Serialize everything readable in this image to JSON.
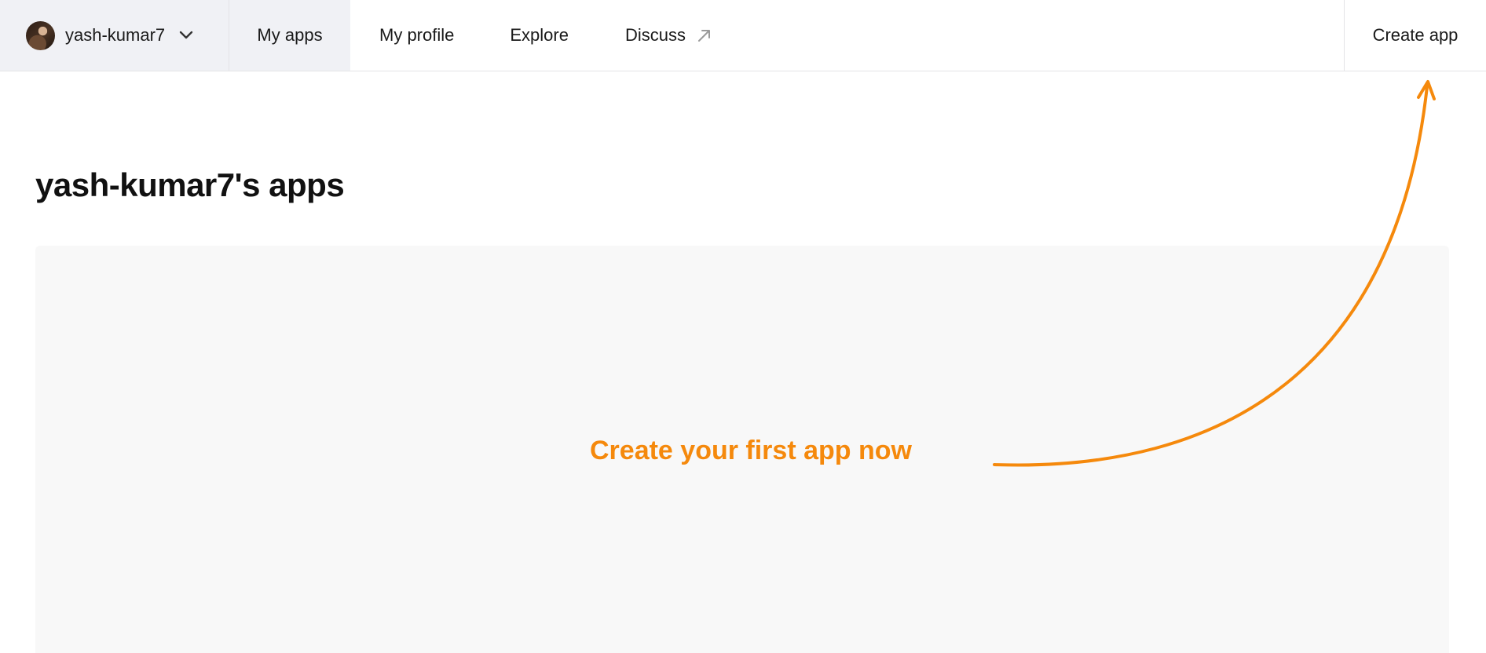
{
  "header": {
    "user": {
      "name": "yash-kumar7",
      "avatar_icon": "user-avatar"
    },
    "nav": [
      {
        "label": "My apps",
        "active": true
      },
      {
        "label": "My profile",
        "active": false
      },
      {
        "label": "Explore",
        "active": false
      },
      {
        "label": "Discuss",
        "active": false,
        "external": true
      }
    ],
    "create_app_label": "Create app"
  },
  "main": {
    "title": "yash-kumar7's apps",
    "empty_state": {
      "cta": "Create your first app now"
    }
  },
  "colors": {
    "accent": "#f5890c",
    "nav_active_bg": "#f0f1f5",
    "panel_bg": "#f8f8f8"
  }
}
